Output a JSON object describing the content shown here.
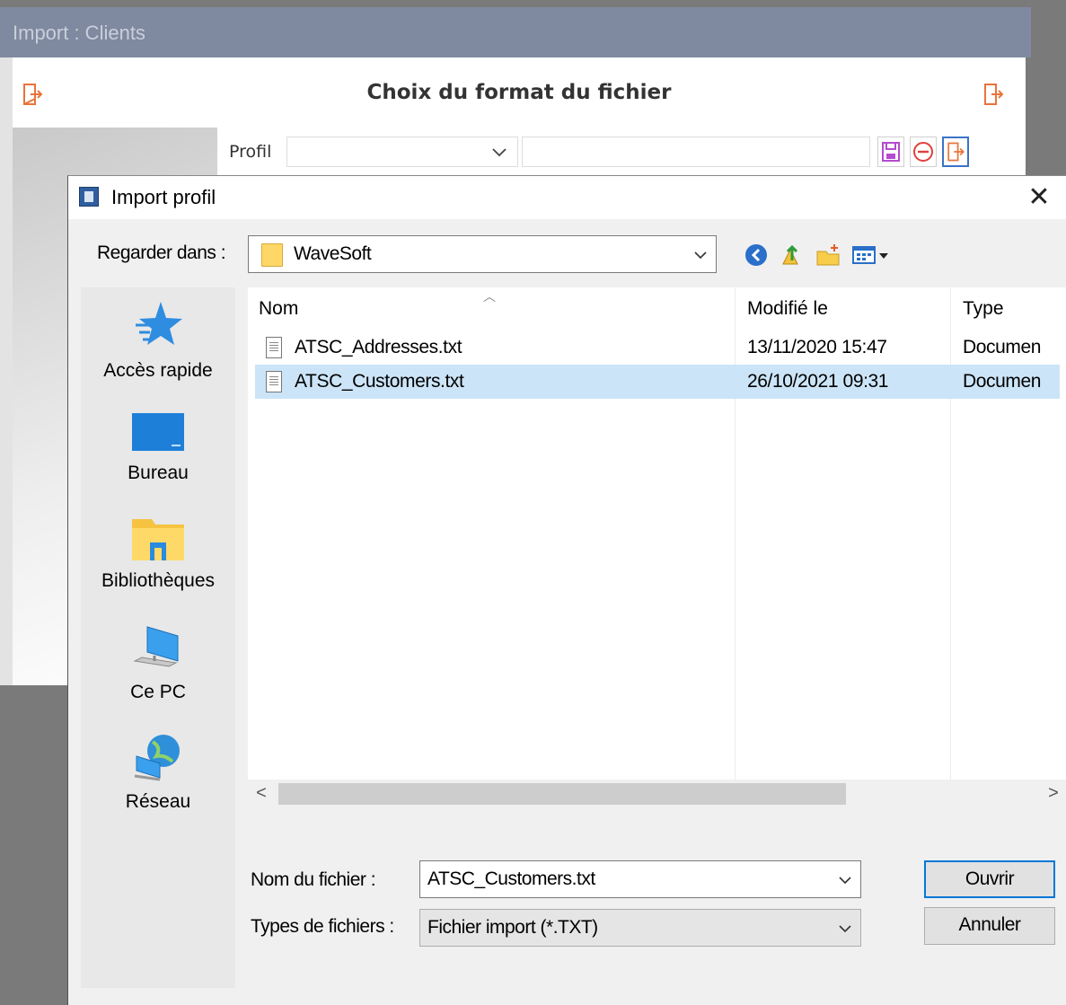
{
  "background_window": {
    "title": "Import : Clients",
    "header_title": "Choix du format du fichier",
    "profile_label": "Profil"
  },
  "dialog": {
    "title": "Import profil",
    "close_glyph": "✕",
    "look_in_label": "Regarder dans :",
    "look_in_value": "WaveSoft",
    "places": [
      {
        "label": "Accès rapide",
        "icon": "quick-access-star-icon"
      },
      {
        "label": "Bureau",
        "icon": "desktop-icon"
      },
      {
        "label": "Bibliothèques",
        "icon": "libraries-icon"
      },
      {
        "label": "Ce PC",
        "icon": "this-pc-icon"
      },
      {
        "label": "Réseau",
        "icon": "network-icon"
      }
    ],
    "columns": {
      "name": "Nom",
      "modified": "Modifié le",
      "type": "Type"
    },
    "files": [
      {
        "name": "ATSC_Addresses.txt",
        "modified": "13/11/2020 15:47",
        "type": "Documen",
        "selected": false
      },
      {
        "name": "ATSC_Customers.txt",
        "modified": "26/10/2021 09:31",
        "type": "Documen",
        "selected": true
      }
    ],
    "file_name_label": "Nom du fichier :",
    "file_name_value": "ATSC_Customers.txt",
    "file_type_label": "Types de fichiers :",
    "file_type_value": "Fichier import (*.TXT)",
    "open_button": "Ouvrir",
    "cancel_button": "Annuler",
    "scroll_left": "<",
    "scroll_right": ">"
  }
}
